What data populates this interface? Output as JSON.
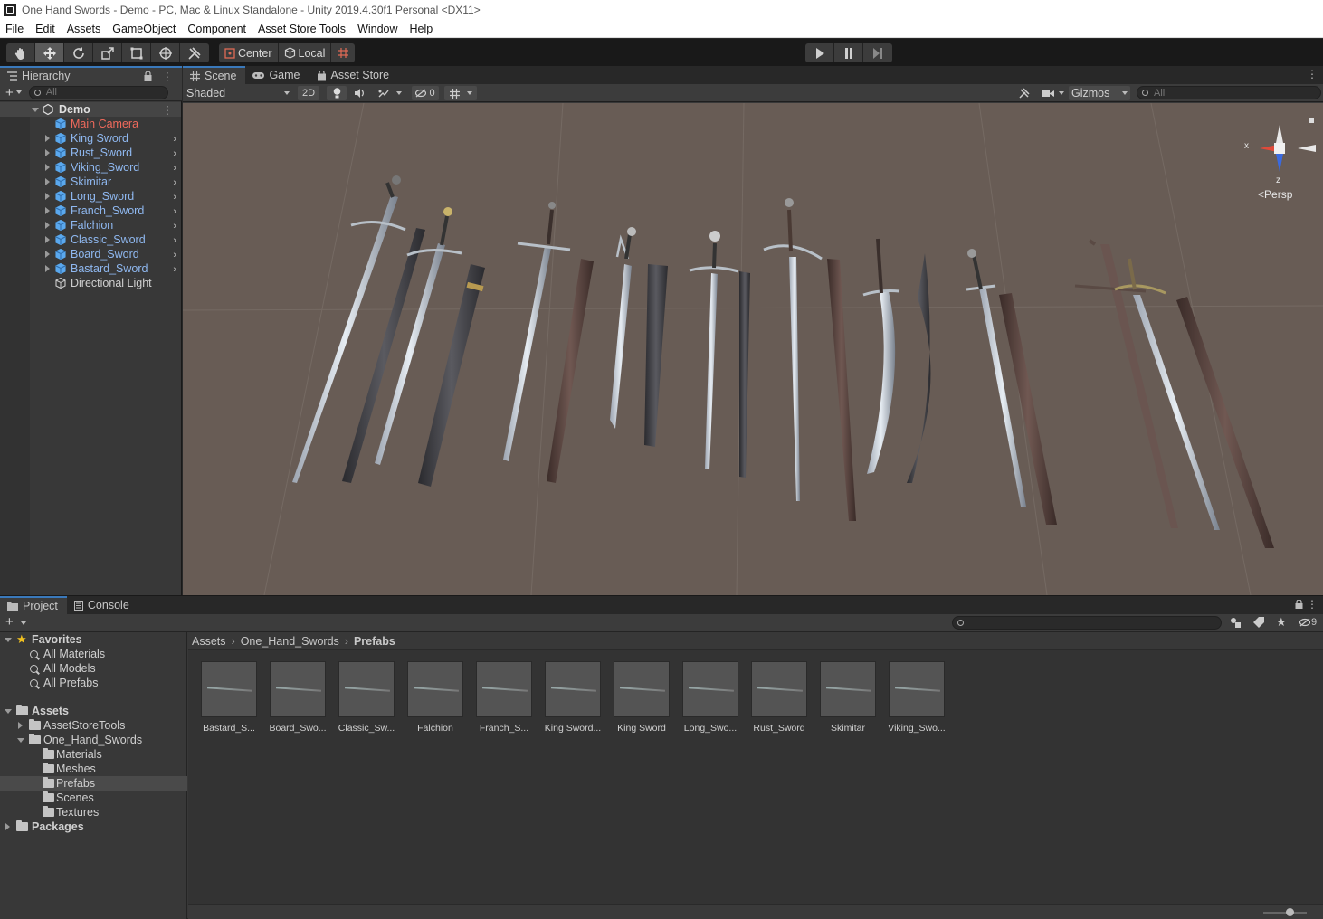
{
  "window": {
    "title": "One Hand Swords - Demo - PC, Mac & Linux Standalone - Unity 2019.4.30f1 Personal <DX11>"
  },
  "menu": [
    "File",
    "Edit",
    "Assets",
    "GameObject",
    "Component",
    "Asset Store Tools",
    "Window",
    "Help"
  ],
  "toolbar": {
    "tools": [
      "hand-tool",
      "move-tool",
      "rotate-tool",
      "scale-tool",
      "rect-tool",
      "transform-tool",
      "custom-tool"
    ],
    "pivot_label": "Center",
    "space_label": "Local"
  },
  "hierarchy": {
    "tab_label": "Hierarchy",
    "search_placeholder": "All",
    "scene_name": "Demo",
    "items": [
      {
        "label": "Main Camera",
        "color": "#f06a5c",
        "expandable": false
      },
      {
        "label": "King Sword",
        "color": "#8fb8f0",
        "expandable": true
      },
      {
        "label": "Rust_Sword",
        "color": "#8fb8f0",
        "expandable": true
      },
      {
        "label": "Viking_Sword",
        "color": "#8fb8f0",
        "expandable": true
      },
      {
        "label": "Skimitar",
        "color": "#8fb8f0",
        "expandable": true
      },
      {
        "label": "Long_Sword",
        "color": "#8fb8f0",
        "expandable": true
      },
      {
        "label": "Franch_Sword",
        "color": "#8fb8f0",
        "expandable": true
      },
      {
        "label": "Falchion",
        "color": "#8fb8f0",
        "expandable": true
      },
      {
        "label": "Classic_Sword",
        "color": "#8fb8f0",
        "expandable": true
      },
      {
        "label": "Board_Sword",
        "color": "#8fb8f0",
        "expandable": true
      },
      {
        "label": "Bastard_Sword",
        "color": "#8fb8f0",
        "expandable": true
      },
      {
        "label": "Directional Light",
        "color": "#d0d0d0",
        "expandable": false
      }
    ]
  },
  "scene_tabs": [
    {
      "label": "Scene",
      "active": true
    },
    {
      "label": "Game",
      "active": false
    },
    {
      "label": "Asset Store",
      "active": false
    }
  ],
  "scene_bar": {
    "shading": "Shaded",
    "mode_2d": "2D",
    "hidden_count": "0",
    "gizmos": "Gizmos",
    "search_placeholder": "All"
  },
  "gizmo": {
    "projection": "Persp",
    "x_label": "x",
    "z_label": "z"
  },
  "project": {
    "tabs": [
      {
        "label": "Project",
        "active": true
      },
      {
        "label": "Console",
        "active": false
      }
    ],
    "favorites_label": "Favorites",
    "favorites": [
      "All Materials",
      "All Models",
      "All Prefabs"
    ],
    "assets_label": "Assets",
    "tree": [
      {
        "label": "AssetStoreTools",
        "depth": 1,
        "expanded": false
      },
      {
        "label": "One_Hand_Swords",
        "depth": 1,
        "expanded": true
      },
      {
        "label": "Materials",
        "depth": 2
      },
      {
        "label": "Meshes",
        "depth": 2
      },
      {
        "label": "Prefabs",
        "depth": 2,
        "selected": true
      },
      {
        "label": "Scenes",
        "depth": 2
      },
      {
        "label": "Textures",
        "depth": 2
      }
    ],
    "packages_label": "Packages",
    "breadcrumb": [
      "Assets",
      "One_Hand_Swords",
      "Prefabs"
    ],
    "hidden_count": "9",
    "assets": [
      "Bastard_S...",
      "Board_Swo...",
      "Classic_Sw...",
      "Falchion",
      "Franch_S...",
      "King Sword...",
      "King Sword",
      "Long_Swo...",
      "Rust_Sword",
      "Skimitar",
      "Viking_Swo..."
    ]
  }
}
